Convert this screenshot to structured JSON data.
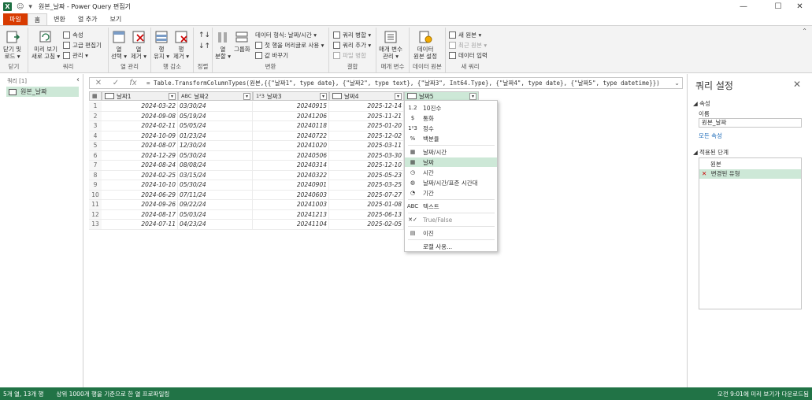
{
  "window": {
    "title": "원본_날짜 - Power Query 편집기",
    "min": "—",
    "max": "☐",
    "close": "✕"
  },
  "tabs": [
    {
      "label": "파일"
    },
    {
      "label": "홈"
    },
    {
      "label": "변환"
    },
    {
      "label": "열 추가"
    },
    {
      "label": "보기"
    }
  ],
  "ribbon": {
    "close_apply": "닫기 및\n로드 ▾",
    "close_group": "닫기",
    "refresh": "미리 보기\n새로 고침 ▾",
    "properties": "속성",
    "advanced_editor": "고급 편집기",
    "manage": "관리 ▾",
    "query_group": "쿼리",
    "choose_cols": "열\n선택 ▾",
    "remove_cols": "열\n제거 ▾",
    "col_manage_group": "열 관리",
    "keep_rows": "행\n유지 ▾",
    "remove_rows": "행\n제거 ▾",
    "row_reduce_group": "행 감소",
    "sort_group": "정렬",
    "split_col": "열\n분할 ▾",
    "group_by": "그룹화",
    "data_type": "데이터 형식: 날짜/시간 ▾",
    "first_row_header": "첫 행을 머리글로 사용 ▾",
    "replace_values": "값 바꾸기",
    "transform_group": "변환",
    "merge_queries": "쿼리 병합 ▾",
    "append_queries": "쿼리 추가 ▾",
    "combine_files": "파일 병합",
    "combine_group": "결합",
    "manage_params": "매개 변수\n관리 ▾",
    "params_group": "매개 변수",
    "data_source_settings": "데이터\n원본 설정",
    "data_source_group": "데이터 원본",
    "new_source": "새 원본 ▾",
    "recent_sources": "최근 원본 ▾",
    "enter_data": "데이터 입력",
    "new_query_group": "새 쿼리"
  },
  "left_pane": {
    "header": "쿼리 [1]",
    "query_item": "원본_날짜",
    "collapse": "‹"
  },
  "formula_bar": {
    "text": "= Table.TransformColumnTypes(원본,{{\"날짜1\", type date}, {\"날짜2\", type text}, {\"날짜3\", Int64.Type}, {\"날짜4\", type date}, {\"날짜5\", type datetime}})"
  },
  "columns": [
    {
      "name": "날짜1",
      "type": "date"
    },
    {
      "name": "날짜2",
      "type": "text"
    },
    {
      "name": "날짜3",
      "type": "number"
    },
    {
      "name": "날짜4",
      "type": "date"
    },
    {
      "name": "날짜5",
      "type": "datetime"
    }
  ],
  "rows": [
    [
      "1",
      "2024-03-22",
      "03/30/24",
      "20240915",
      "2025-12-14"
    ],
    [
      "2",
      "2024-09-08",
      "05/19/24",
      "20241206",
      "2025-11-21"
    ],
    [
      "3",
      "2024-02-11",
      "05/05/24",
      "20240118",
      "2025-01-20"
    ],
    [
      "4",
      "2024-10-09",
      "01/23/24",
      "20240722",
      "2025-12-02"
    ],
    [
      "5",
      "2024-08-07",
      "12/30/24",
      "20241020",
      "2025-03-11"
    ],
    [
      "6",
      "2024-12-29",
      "05/30/24",
      "20240506",
      "2025-03-30"
    ],
    [
      "7",
      "2024-08-24",
      "08/08/24",
      "20240314",
      "2025-12-10"
    ],
    [
      "8",
      "2024-02-25",
      "03/15/24",
      "20240322",
      "2025-05-23"
    ],
    [
      "9",
      "2024-10-10",
      "05/30/24",
      "20240901",
      "2025-03-25"
    ],
    [
      "10",
      "2024-06-29",
      "07/11/24",
      "20240603",
      "2025-07-27"
    ],
    [
      "11",
      "2024-09-26",
      "09/22/24",
      "20241003",
      "2025-01-08"
    ],
    [
      "12",
      "2024-08-17",
      "05/03/24",
      "20241213",
      "2025-06-13"
    ],
    [
      "13",
      "2024-07-11",
      "04/23/24",
      "20241104",
      "2025-02-05"
    ]
  ],
  "type_menu": [
    {
      "icon": "1.2",
      "label": "10진수"
    },
    {
      "icon": "$",
      "label": "통화"
    },
    {
      "icon": "1²3",
      "label": "정수"
    },
    {
      "icon": "%",
      "label": "백분율"
    },
    {
      "icon": "▦",
      "label": "날짜/시간"
    },
    {
      "icon": "▦",
      "label": "날짜",
      "selected": true
    },
    {
      "icon": "◷",
      "label": "시간"
    },
    {
      "icon": "◍",
      "label": "날짜/시간/표준 시간대"
    },
    {
      "icon": "◔",
      "label": "기간"
    },
    {
      "icon": "ABC",
      "label": "텍스트"
    },
    {
      "icon": "✕✓",
      "label": "True/False",
      "dim": true
    },
    {
      "icon": "▤",
      "label": "이진"
    },
    {
      "icon": "",
      "label": "로캘 사용..."
    }
  ],
  "right_pane": {
    "title": "쿼리 설정",
    "close": "✕",
    "properties_section": "◢ 속성",
    "name_label": "이름",
    "name_value": "원본_날짜",
    "all_properties": "모든 속성",
    "steps_section": "◢ 적용된 단계",
    "steps": [
      "원본",
      "변경된 유형"
    ]
  },
  "status": {
    "left": "5개 열, 13개 행",
    "middle": "상위 1000개 행을 기준으로 한 열 프로파일링",
    "right": "오전 9:01에 미리 보기가 다운로드됨"
  },
  "colors": {
    "accent": "#217346",
    "file_tab": "#d83b01",
    "selection": "#cde8d7"
  }
}
